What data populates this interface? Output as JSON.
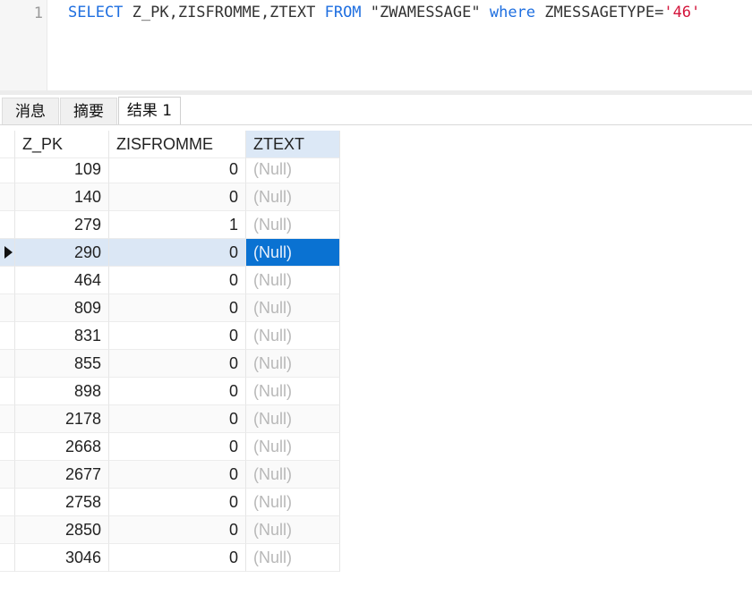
{
  "editor": {
    "line_number": "1",
    "sql": {
      "kw_select": "SELECT",
      "columns": " Z_PK,ZISFROMME,ZTEXT ",
      "kw_from": "FROM",
      "table": " \"ZWAMESSAGE\" ",
      "kw_where": "where",
      "condition": " ZMESSAGETYPE=",
      "value": "'46'"
    }
  },
  "tabs": [
    {
      "label": "消息",
      "active": false
    },
    {
      "label": "摘要",
      "active": false
    },
    {
      "label": "结果 1",
      "active": true
    }
  ],
  "grid": {
    "columns": [
      "Z_PK",
      "ZISFROMME",
      "ZTEXT"
    ],
    "rows": [
      {
        "z_pk": "109",
        "zisfromme": "0",
        "ztext": "(Null)"
      },
      {
        "z_pk": "140",
        "zisfromme": "0",
        "ztext": "(Null)"
      },
      {
        "z_pk": "279",
        "zisfromme": "1",
        "ztext": "(Null)"
      },
      {
        "z_pk": "290",
        "zisfromme": "0",
        "ztext": "(Null)"
      },
      {
        "z_pk": "464",
        "zisfromme": "0",
        "ztext": "(Null)"
      },
      {
        "z_pk": "809",
        "zisfromme": "0",
        "ztext": "(Null)"
      },
      {
        "z_pk": "831",
        "zisfromme": "0",
        "ztext": "(Null)"
      },
      {
        "z_pk": "855",
        "zisfromme": "0",
        "ztext": "(Null)"
      },
      {
        "z_pk": "898",
        "zisfromme": "0",
        "ztext": "(Null)"
      },
      {
        "z_pk": "2178",
        "zisfromme": "0",
        "ztext": "(Null)"
      },
      {
        "z_pk": "2668",
        "zisfromme": "0",
        "ztext": "(Null)"
      },
      {
        "z_pk": "2677",
        "zisfromme": "0",
        "ztext": "(Null)"
      },
      {
        "z_pk": "2758",
        "zisfromme": "0",
        "ztext": "(Null)"
      },
      {
        "z_pk": "2850",
        "zisfromme": "0",
        "ztext": "(Null)"
      },
      {
        "z_pk": "3046",
        "zisfromme": "0",
        "ztext": "(Null)"
      }
    ],
    "selected_row": 3,
    "selected_column": "ZTEXT"
  },
  "colors": {
    "keyword": "#1f6fe0",
    "string": "#d4163c",
    "selection": "#0a72d2",
    "selected_row": "#dbe7f5",
    "null_text": "#b8b8b8"
  },
  "icons": {
    "row_cursor": "current-row-arrow-icon"
  }
}
